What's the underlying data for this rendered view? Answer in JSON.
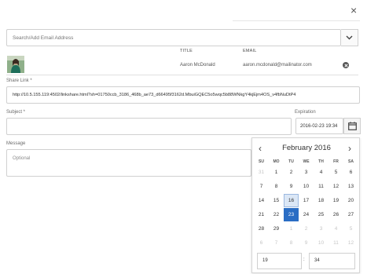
{
  "dialog": {
    "close_glyph": "×"
  },
  "search": {
    "placeholder": "Search/Add Email Address"
  },
  "recipients": {
    "headers": {
      "title": "TITLE",
      "email": "EMAIL"
    },
    "rows": [
      {
        "name": "Aaron McDonald",
        "email": "aaron.mcdonald@mailinator.com"
      }
    ]
  },
  "share_link": {
    "label": "Share Link *",
    "value": "http://10.5.155.119:4502/linkshare.html?sh=01750ccb_3186_468b_ae73_d66495f3162d.MbuiGQEC5o5wqc5b88WNkgY4kjEjm4OS_v4fbNuDtP4"
  },
  "subject": {
    "label": "Subject *",
    "value": ""
  },
  "expiration": {
    "label": "Expiration",
    "value": "2016-02-23 19:34"
  },
  "message": {
    "label": "Message",
    "placeholder": "Optional"
  },
  "calendar": {
    "prev_glyph": "‹",
    "next_glyph": "›",
    "month_title": "February 2016",
    "weekdays": [
      "SU",
      "MO",
      "TU",
      "WE",
      "TH",
      "FR",
      "SA"
    ],
    "weeks": [
      [
        "31",
        "1",
        "2",
        "3",
        "4",
        "5",
        "6"
      ],
      [
        "7",
        "8",
        "9",
        "10",
        "11",
        "12",
        "13"
      ],
      [
        "14",
        "15",
        "16",
        "17",
        "18",
        "19",
        "20"
      ],
      [
        "21",
        "22",
        "23",
        "24",
        "25",
        "26",
        "27"
      ],
      [
        "28",
        "29",
        "1",
        "2",
        "3",
        "4",
        "5"
      ],
      [
        "6",
        "7",
        "8",
        "9",
        "10",
        "11",
        "12"
      ]
    ],
    "today": "16",
    "selected": "23",
    "hour": "19",
    "time_separator": ":",
    "minute": "34"
  },
  "icons": [
    "close-icon",
    "chevron-down-icon",
    "remove-icon",
    "calendar-icon",
    "prev-month-icon",
    "next-month-icon"
  ],
  "colors": {
    "accent": "#2a6dc4",
    "today_bg": "#dbe7f6"
  }
}
